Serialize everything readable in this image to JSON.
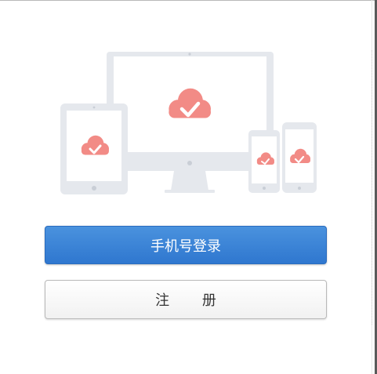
{
  "illustration": {
    "icon": "cloud-check-icon",
    "device_color": "#e5e8ed",
    "cloud_color": "#f28b86"
  },
  "buttons": {
    "login_label": "手机号登录",
    "register_label": "注 册"
  }
}
